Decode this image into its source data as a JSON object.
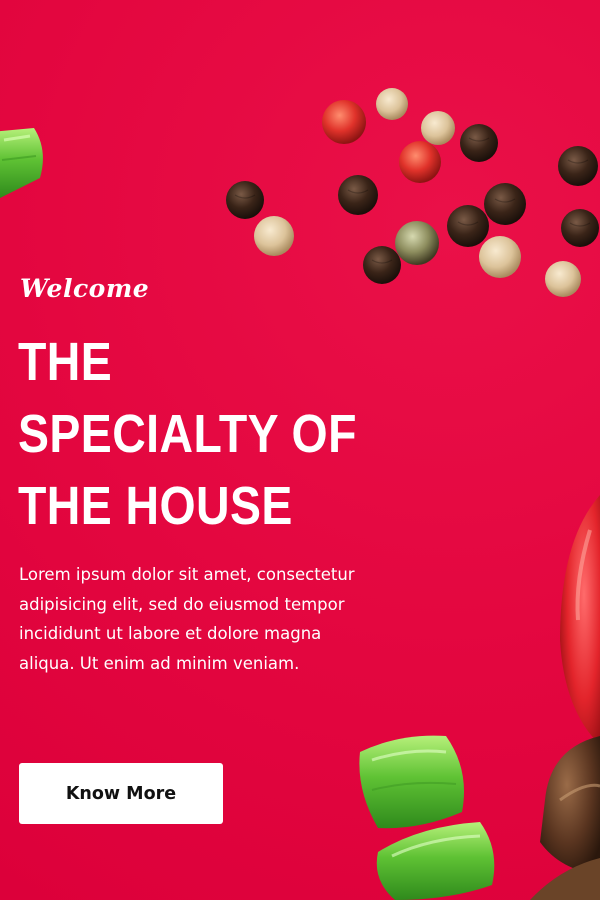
{
  "hero": {
    "welcome": "Welcome",
    "title_lines": [
      "THE",
      "SPECIALTY OF",
      "THE HOUSE"
    ],
    "description": "Lorem ipsum dolor sit amet, consectetur adipisicing elit, sed do eiusmod tempor incididunt ut labore et dolore magna aliqua. Ut enim ad minim veniam.",
    "cta_label": "Know More"
  },
  "theme": {
    "background": "#E3063F",
    "button_bg": "#FFFFFF",
    "button_text": "#111111",
    "text": "#FFFFFF"
  },
  "icons": [
    "green-onion-icon",
    "peppercorn-icon",
    "tomato-icon",
    "mushroom-icon"
  ]
}
